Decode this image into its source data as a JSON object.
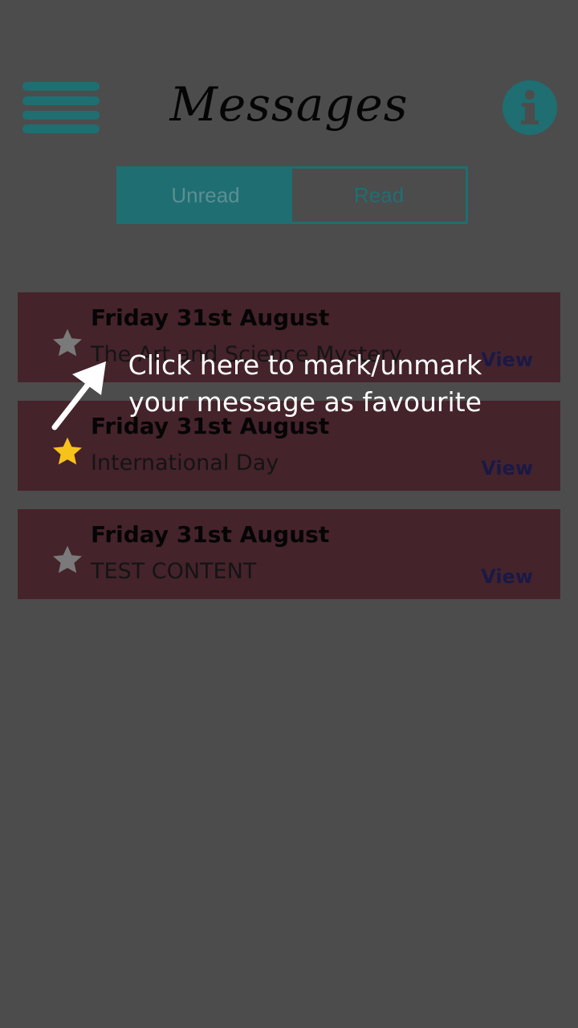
{
  "header": {
    "title": "Messages",
    "menu_icon": "hamburger-menu-icon",
    "info_icon": "info-icon"
  },
  "tabs": [
    {
      "label": "Unread",
      "active": true
    },
    {
      "label": "Read",
      "active": false
    }
  ],
  "messages": [
    {
      "date": "Friday 31st August",
      "subject": "The Art and Science Mystery",
      "favourite": false,
      "view_label": "View"
    },
    {
      "date": "Friday 31st August",
      "subject": "International Day",
      "favourite": true,
      "view_label": "View"
    },
    {
      "date": "Friday 31st August",
      "subject": "TEST CONTENT",
      "favourite": false,
      "view_label": "View"
    }
  ],
  "tooltip": {
    "line1": "Click here to mark/unmark",
    "line2": "your message as favourite"
  },
  "colors": {
    "overlay": "#4c4c4c",
    "accent_teal": "#1f6e72",
    "card_bg": "#45232b",
    "star_active": "#f7c21c",
    "star_inactive": "#7a7a7a"
  }
}
